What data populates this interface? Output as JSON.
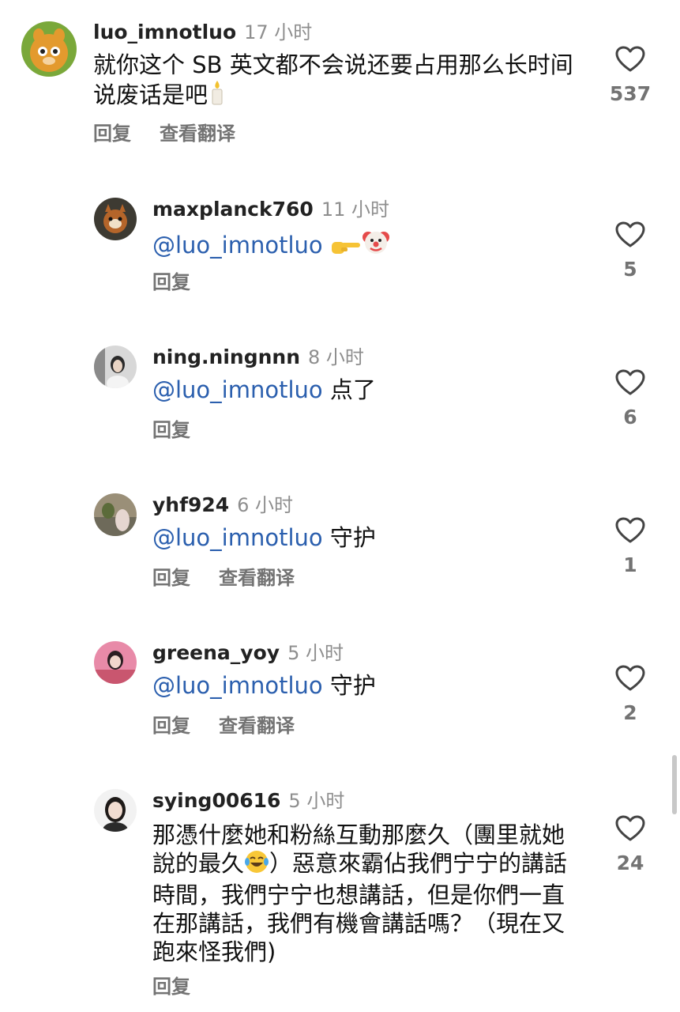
{
  "comments": [
    {
      "username": "luo_imnotluo",
      "time": "17 小时",
      "text": "就你这个 SB 英文都不会说还要占用那么长时间说废话是吧",
      "emoji": "candle-emoji",
      "reply_label": "回复",
      "translate_label": "查看翻译",
      "likes": "537"
    },
    {
      "username": "maxplanck760",
      "time": "11 小时",
      "mention": "@luo_imnotluo",
      "text": "",
      "emoji": "pointing-hand-and-clown-emoji",
      "reply_label": "回复",
      "likes": "5"
    },
    {
      "username": "ning.ningnnn",
      "time": "8 小时",
      "mention": "@luo_imnotluo",
      "text": " 点了",
      "reply_label": "回复",
      "likes": "6"
    },
    {
      "username": "yhf924",
      "time": "6 小时",
      "mention": "@luo_imnotluo",
      "text": " 守护",
      "reply_label": "回复",
      "translate_label": "查看翻译",
      "likes": "1"
    },
    {
      "username": "greena_yoy",
      "time": "5 小时",
      "mention": "@luo_imnotluo",
      "text": " 守护",
      "reply_label": "回复",
      "translate_label": "查看翻译",
      "likes": "2"
    },
    {
      "username": "sying00616",
      "time": "5 小时",
      "text_part1": "那憑什麼她和粉絲互動那麼久（團里就她說的最久",
      "text_part2": "）惡意來霸佔我們宁宁的講話時間，我們宁宁也想講話，但是你們一直在那講話，我們有機會講話嗎？（現在又跑來怪我們)",
      "emoji": "tears-of-joy-emoji",
      "reply_label": "回复",
      "likes": "24"
    }
  ],
  "colors": {
    "mention": "#2b5fae",
    "secondary_text": "#737373",
    "timestamp": "#8e8e8e"
  }
}
